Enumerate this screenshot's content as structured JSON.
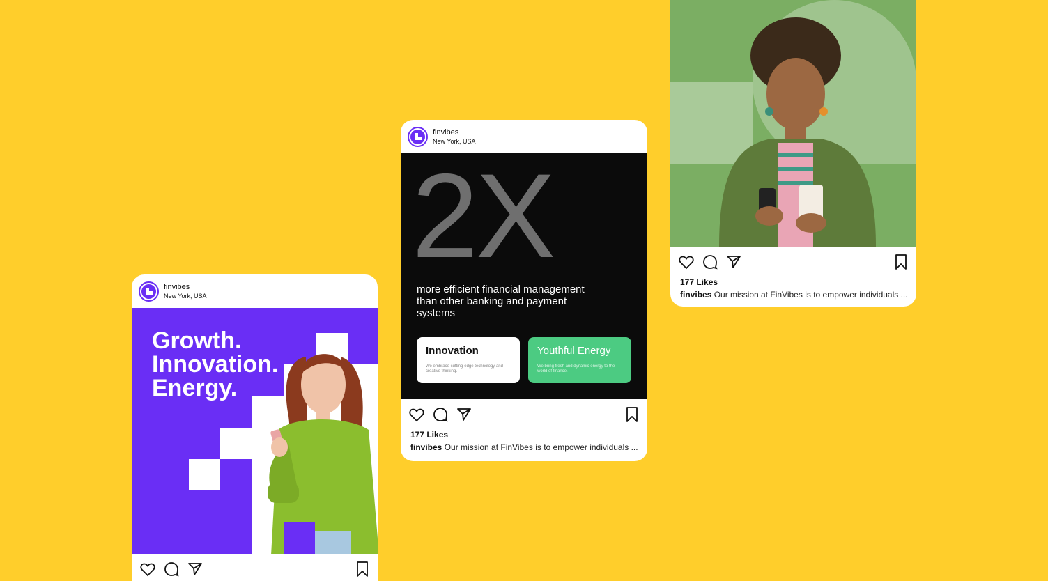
{
  "account": {
    "name": "finvibes",
    "location": "New York, USA"
  },
  "post_left": {
    "headline": [
      "Growth.",
      "Innovation.",
      "Energy."
    ]
  },
  "post_mid": {
    "big_stat": "2X",
    "description": "more efficient financial management than other banking and payment systems",
    "box1": {
      "title": "Innovation",
      "subtitle": "We embrace cutting-edge technology and creative thinking."
    },
    "box2": {
      "title": "Youthful Energy",
      "subtitle": "We bring fresh and dynamic energy to the world of finance."
    },
    "likes": "177 Likes",
    "caption_user": "finvibes",
    "caption_text": " Our mission at FinVibes is to empower individuals ..."
  },
  "post_right": {
    "likes": "177 Likes",
    "caption_user": "finvibes",
    "caption_text": " Our mission at FinVibes is to empower individuals ..."
  },
  "icons": [
    "heart-icon",
    "comment-icon",
    "share-icon",
    "bookmark-icon"
  ],
  "colors": {
    "background": "#FFCE2B",
    "brand_purple": "#6A2EF5",
    "accent_green": "#4CCB82",
    "photo_green": "#7BAE63"
  }
}
